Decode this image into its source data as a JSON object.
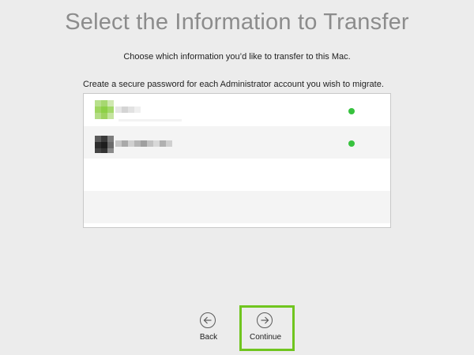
{
  "header": {
    "title": "Select the Information to Transfer",
    "subtitle": "Choose which information you’d like to transfer to this Mac."
  },
  "accounts": {
    "caption": "Create a secure password for each Administrator account you wish to migrate.",
    "status_color": "#37c23e",
    "rows": [
      {
        "name": "",
        "status": "ok"
      },
      {
        "name": "",
        "status": "ok"
      }
    ]
  },
  "navigation": {
    "back_label": "Back",
    "continue_label": "Continue",
    "back_icon": "arrow-left-circle-icon",
    "continue_icon": "arrow-right-circle-icon",
    "highlight_color": "#70c51f"
  }
}
